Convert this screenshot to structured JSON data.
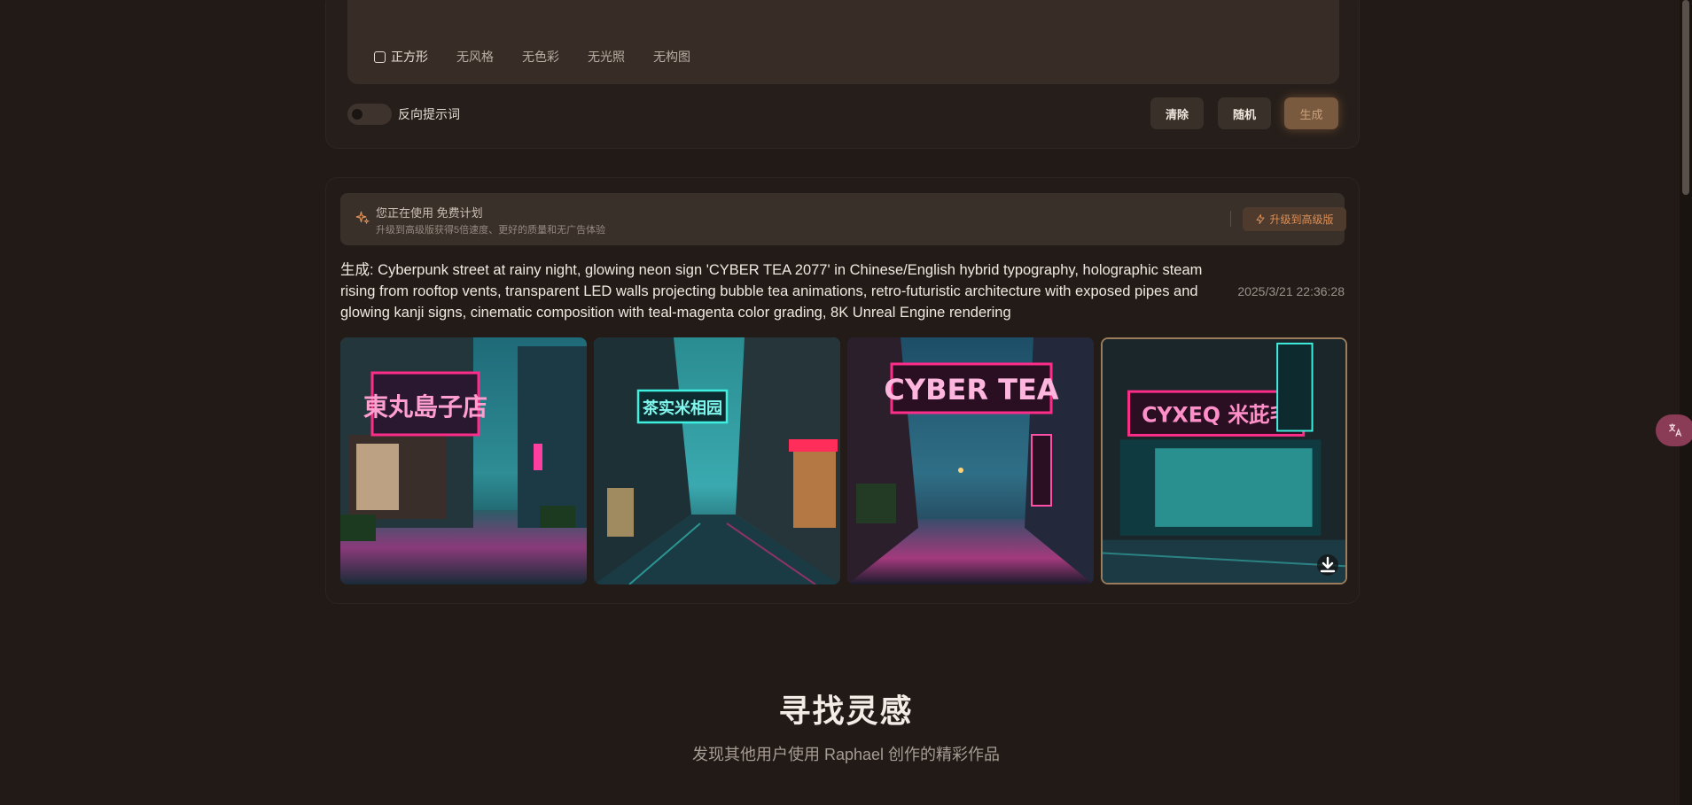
{
  "prompt_panel": {
    "chips": [
      {
        "label": "正方形",
        "checkbox": true
      },
      {
        "label": "无风格"
      },
      {
        "label": "无色彩"
      },
      {
        "label": "无光照"
      },
      {
        "label": "无构图"
      }
    ],
    "negative_prompt_label": "反向提示词",
    "clear_label": "清除",
    "random_label": "随机",
    "generate_label": "生成"
  },
  "plan_banner": {
    "title": "您正在使用 免费计划",
    "subtitle": "升级到高级版获得5倍速度、更好的质量和无广告体验",
    "upgrade_label": "升级到高级版",
    "icon": "sparkle-icon",
    "upgrade_icon": "lightning-icon"
  },
  "result": {
    "text": "生成: Cyberpunk street at rainy night, glowing neon sign 'CYBER TEA 2077' in Chinese/English hybrid typography, holographic steam rising from rooftop vents, transparent LED walls projecting bubble tea animations, retro-futuristic architecture with exposed pipes and glowing kanji signs, cinematic composition with teal-magenta color grading, 8K Unreal Engine rendering",
    "timestamp": "2025/3/21 22:36:28",
    "images": [
      {
        "sign": "東丸島子店"
      },
      {
        "sign": "茶实米相园"
      },
      {
        "sign": "CYBER TEA"
      },
      {
        "sign": "CYXEQ 米茈毛"
      }
    ],
    "download_icon": "download-icon"
  },
  "inspiration": {
    "title": "寻找灵感",
    "subtitle": "发现其他用户使用 Raphael 创作的精彩作品"
  },
  "colors": {
    "background": "#211a16",
    "accent": "#d9905a",
    "neon_pink": "#ff2d8a",
    "neon_teal": "#3ff0e0"
  }
}
